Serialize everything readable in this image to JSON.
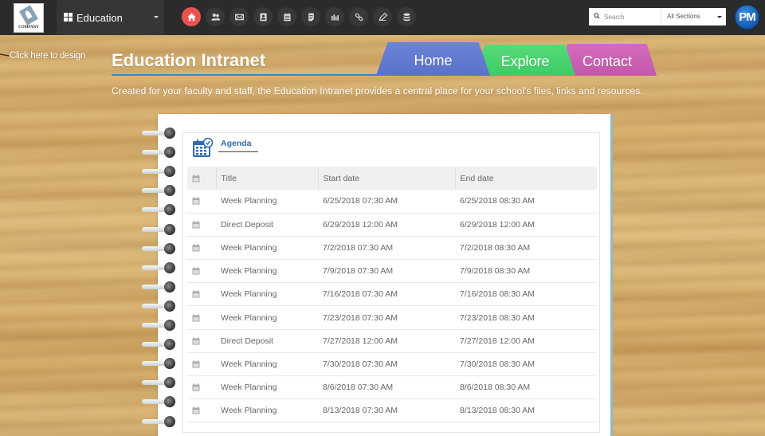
{
  "topbar": {
    "logo_text": "COMPANY",
    "site_selector": "Education",
    "nav_icons": [
      {
        "name": "home-icon",
        "active": true
      },
      {
        "name": "people-icon",
        "active": false
      },
      {
        "name": "mail-icon",
        "active": false
      },
      {
        "name": "contact-card-icon",
        "active": false
      },
      {
        "name": "calendar-icon",
        "active": false
      },
      {
        "name": "document-icon",
        "active": false
      },
      {
        "name": "bar-chart-icon",
        "active": false
      },
      {
        "name": "link-icon",
        "active": false
      },
      {
        "name": "pencil-icon",
        "active": false
      },
      {
        "name": "database-icon",
        "active": false
      }
    ],
    "search_placeholder": "Search",
    "search_value": "",
    "sections_selected": "All Sections",
    "avatar_initials": "PM",
    "accent_active": "#e9534f"
  },
  "header": {
    "design_link": "Click here to design",
    "title": "Education Intranet",
    "tagline": "Created for your faculty and staff, the Education Intranet provides a central place for your school's files, links and resources.",
    "tabs": [
      {
        "label": "Home",
        "color": "#6078cc"
      },
      {
        "label": "Explore",
        "color": "#45d16c"
      },
      {
        "label": "Contact",
        "color": "#c95fb1"
      }
    ]
  },
  "agenda": {
    "tab_label": "Agenda",
    "columns": [
      "Title",
      "Start date",
      "End date"
    ],
    "rows": [
      {
        "title": "Week Planning",
        "start": "6/25/2018 07:30 AM",
        "end": "6/25/2018 08:30 AM"
      },
      {
        "title": "Direct Deposit",
        "start": "6/29/2018 12:00 AM",
        "end": "6/29/2018 12:00 AM"
      },
      {
        "title": "Week Planning",
        "start": "7/2/2018 07:30 AM",
        "end": "7/2/2018 08:30 AM"
      },
      {
        "title": "Week Planning",
        "start": "7/9/2018 07:30 AM",
        "end": "7/9/2018 08:30 AM"
      },
      {
        "title": "Week Planning",
        "start": "7/16/2018 07:30 AM",
        "end": "7/16/2018 08:30 AM"
      },
      {
        "title": "Week Planning",
        "start": "7/23/2018 07:30 AM",
        "end": "7/23/2018 08:30 AM"
      },
      {
        "title": "Direct Deposit",
        "start": "7/27/2018 12:00 AM",
        "end": "7/27/2018 12:00 AM"
      },
      {
        "title": "Week Planning",
        "start": "7/30/2018 07:30 AM",
        "end": "7/30/2018 08:30 AM"
      },
      {
        "title": "Week Planning",
        "start": "8/6/2018 07:30 AM",
        "end": "8/6/2018 08:30 AM"
      },
      {
        "title": "Week Planning",
        "start": "8/13/2018 07:30 AM",
        "end": "8/13/2018 08:30 AM"
      }
    ]
  }
}
